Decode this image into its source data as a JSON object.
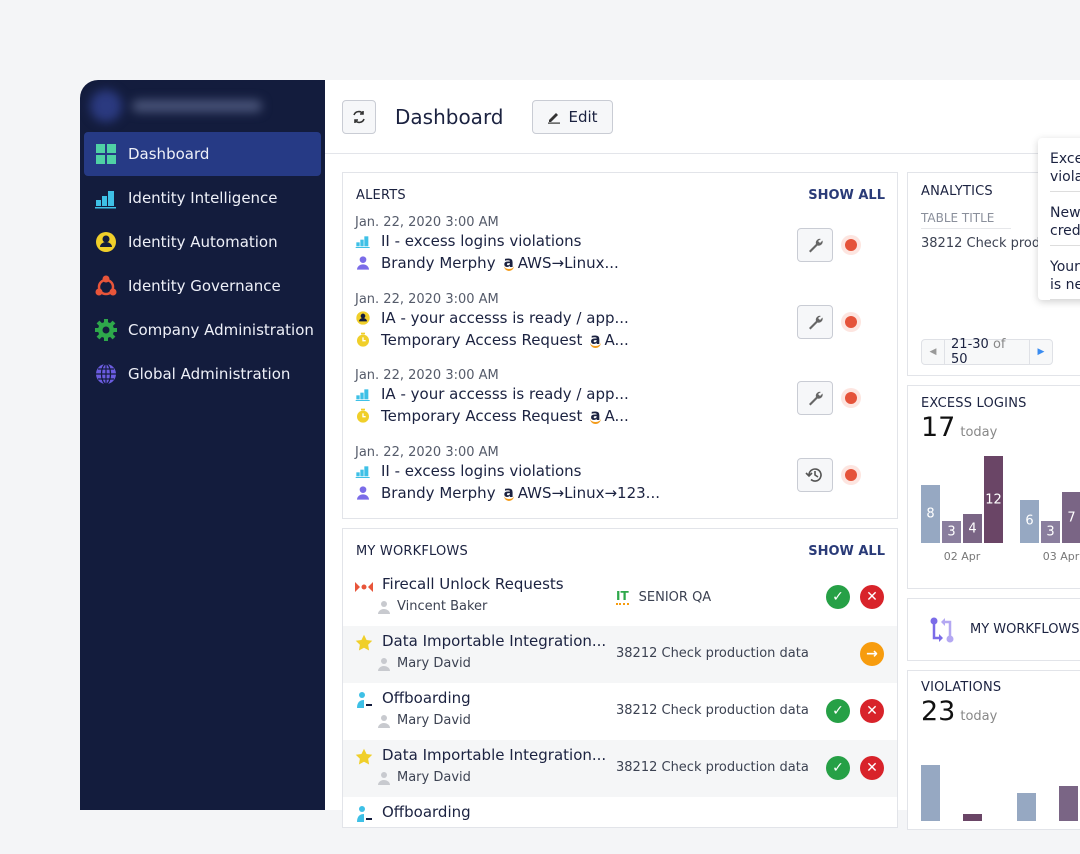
{
  "sidebar": {
    "items": [
      {
        "label": "Dashboard",
        "icon": "grid-icon",
        "active": true
      },
      {
        "label": "Identity Intelligence",
        "icon": "bar-chart-icon"
      },
      {
        "label": "Identity Automation",
        "icon": "user-circle-icon"
      },
      {
        "label": "Identity Governance",
        "icon": "network-icon"
      },
      {
        "label": "Company Administration",
        "icon": "gear-icon"
      },
      {
        "label": "Global Administration",
        "icon": "globe-icon"
      }
    ]
  },
  "header": {
    "title": "Dashboard",
    "edit_label": "Edit"
  },
  "alerts": {
    "title": "ALERTS",
    "show_all": "SHOW ALL",
    "items": [
      {
        "date": "Jan. 22, 2020 3:00 AM",
        "line1": "II - excess logins violations",
        "line1_icon": "bar-chart-icon",
        "line2": "Brandy Merphy",
        "line2_icon": "user-icon",
        "target": "AWS→Linux...",
        "action": "wrench-icon"
      },
      {
        "date": "Jan. 22, 2020 3:00 AM",
        "line1": "IA - your accesss is ready / app...",
        "line1_icon": "user-circle-icon",
        "line2": "Temporary Access Request",
        "line2_icon": "timer-icon",
        "target": "A...",
        "action": "wrench-icon"
      },
      {
        "date": "Jan. 22, 2020 3:00 AM",
        "line1": "IA - your accesss is ready / app...",
        "line1_icon": "bar-chart-icon",
        "line2": "Temporary Access Request",
        "line2_icon": "timer-icon",
        "target": "A...",
        "action": "wrench-icon"
      },
      {
        "date": "Jan. 22, 2020 3:00 AM",
        "line1": "II - excess logins violations",
        "line1_icon": "bar-chart-icon",
        "line2": "Brandy Merphy",
        "line2_icon": "user-icon",
        "target": "AWS→Linux→123...",
        "action": "history-icon"
      }
    ]
  },
  "workflows": {
    "title": "MY WORKFLOWS",
    "show_all": "SHOW ALL",
    "items": [
      {
        "title": "Firecall Unlock Requests",
        "user": "Vincent Baker",
        "detail": "SENIOR QA",
        "badge": "IT",
        "icon": "firecall-icon",
        "actions": [
          "approve",
          "reject"
        ]
      },
      {
        "title": "Data Importable Integration...",
        "user": "Mary David",
        "detail": "38212 Check production data",
        "icon": "star-icon",
        "actions": [
          "proceed"
        ]
      },
      {
        "title": "Offboarding",
        "user": "Mary David",
        "detail": "38212 Check production data",
        "icon": "offboard-icon",
        "actions": [
          "approve",
          "reject"
        ]
      },
      {
        "title": "Data Importable Integration...",
        "user": "Mary David",
        "detail": "38212 Check production data",
        "icon": "star-icon",
        "actions": [
          "approve",
          "reject"
        ]
      },
      {
        "title": "Offboarding",
        "icon": "offboard-icon"
      }
    ]
  },
  "analytics": {
    "title": "ANALYTICS",
    "table_title": "TABLE TITLE",
    "row": "38212 Check produ",
    "pager": {
      "range": "21-30",
      "of": "of",
      "total": "50"
    }
  },
  "excess_logins": {
    "title": "EXCESS LOGINS",
    "count": "17",
    "today": "today"
  },
  "my_workflows_card": {
    "label": "MY WORKFLOWS"
  },
  "violations": {
    "title": "VIOLATIONS",
    "count": "23",
    "today": "today"
  },
  "tooltip": {
    "items": [
      "Exce\nviola",
      "New\ncred",
      "Your\nis ne"
    ]
  },
  "colors": {
    "sidebar": "#131c3d",
    "active": "#263a85",
    "bars": [
      "#96a8c2",
      "#8a7e9e",
      "#7a6585",
      "#6a4566"
    ]
  },
  "chart_data": [
    {
      "type": "bar",
      "title": "EXCESS LOGINS",
      "categories": [
        "02 Apr",
        "03 Apr"
      ],
      "series": [
        {
          "values": [
            8,
            6
          ]
        },
        {
          "values": [
            3,
            3
          ]
        },
        {
          "values": [
            4,
            7
          ]
        },
        {
          "values": [
            12,
            null
          ]
        }
      ]
    },
    {
      "type": "bar",
      "title": "VIOLATIONS",
      "categories": [
        "",
        ""
      ],
      "series": [
        {
          "values": [
            8,
            4
          ]
        },
        {
          "values": [
            1,
            5
          ]
        }
      ]
    }
  ]
}
